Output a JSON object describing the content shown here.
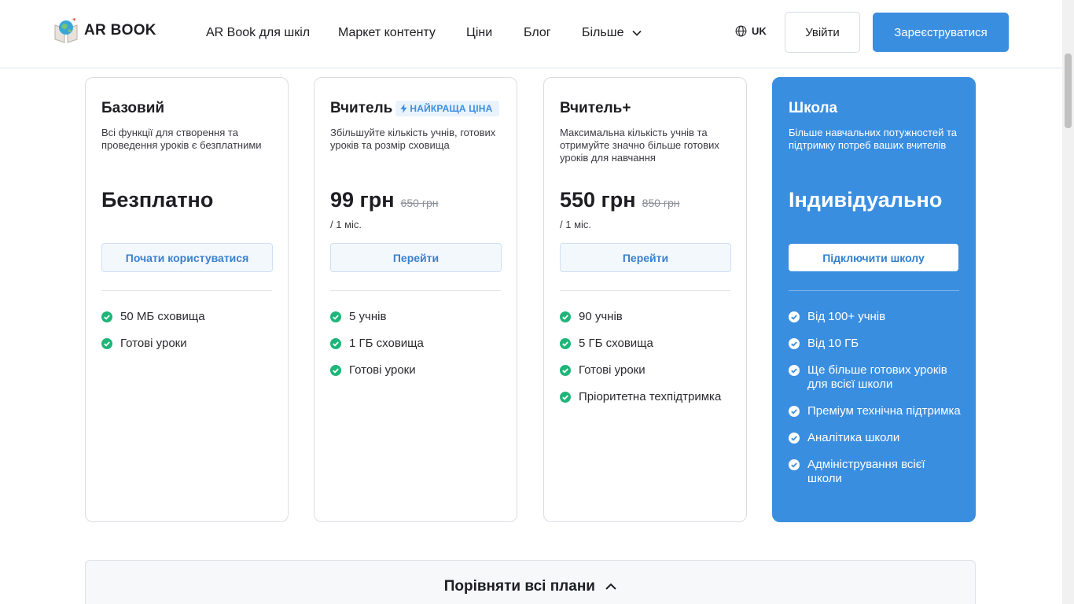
{
  "header": {
    "logo_text": "AR BOOK",
    "nav": [
      {
        "label": "AR Book для шкіл"
      },
      {
        "label": "Маркет контенту"
      },
      {
        "label": "Ціни"
      },
      {
        "label": "Блог"
      },
      {
        "label": "Більше"
      }
    ],
    "language": "UK",
    "login_label": "Увійти",
    "signup_label": "Зареєструватися"
  },
  "plans": [
    {
      "title": "Базовий",
      "badge": "",
      "description": "Всі функції для створення та проведення уроків є безплатними",
      "price": "Безплатно",
      "old_price": "",
      "period": "",
      "button": "Почати користуватися",
      "features": [
        "50 МБ сховища",
        "Готові уроки"
      ]
    },
    {
      "title": "Вчитель",
      "badge": "НАЙКРАЩА ЦІНА",
      "description": "Збільшуйте кількість учнів, готових уроків та розмір сховища",
      "price": "99 грн",
      "old_price": "650 грн",
      "period": "/ 1 міс.",
      "button": "Перейти",
      "features": [
        "5 учнів",
        "1 ГБ сховища",
        "Готові уроки"
      ]
    },
    {
      "title": "Вчитель+",
      "badge": "",
      "description": "Максимальна кількість учнів та отримуйте значно більше готових уроків для навчання",
      "price": "550 грн",
      "old_price": "850 грн",
      "period": "/ 1 міс.",
      "button": "Перейти",
      "features": [
        "90 учнів",
        "5 ГБ сховища",
        "Готові уроки",
        "Пріоритетна техпідтримка"
      ]
    },
    {
      "title": "Школа",
      "badge": "",
      "description": "Більше навчальних потужностей та підтримку потреб ваших вчителів",
      "price": "Індивідуально",
      "old_price": "",
      "period": "",
      "button": "Підключити школу",
      "features": [
        "Від 100+ учнів",
        "Від 10 ГБ",
        "Ще більше готових уроків для всієї школи",
        "Преміум технічна підтримка",
        "Аналітика школи",
        "Адміністрування всієї школи"
      ]
    }
  ],
  "compare_label": "Порівняти всі плани",
  "colors": {
    "accent": "#3a8ee0",
    "check_green": "#1fb57a"
  }
}
